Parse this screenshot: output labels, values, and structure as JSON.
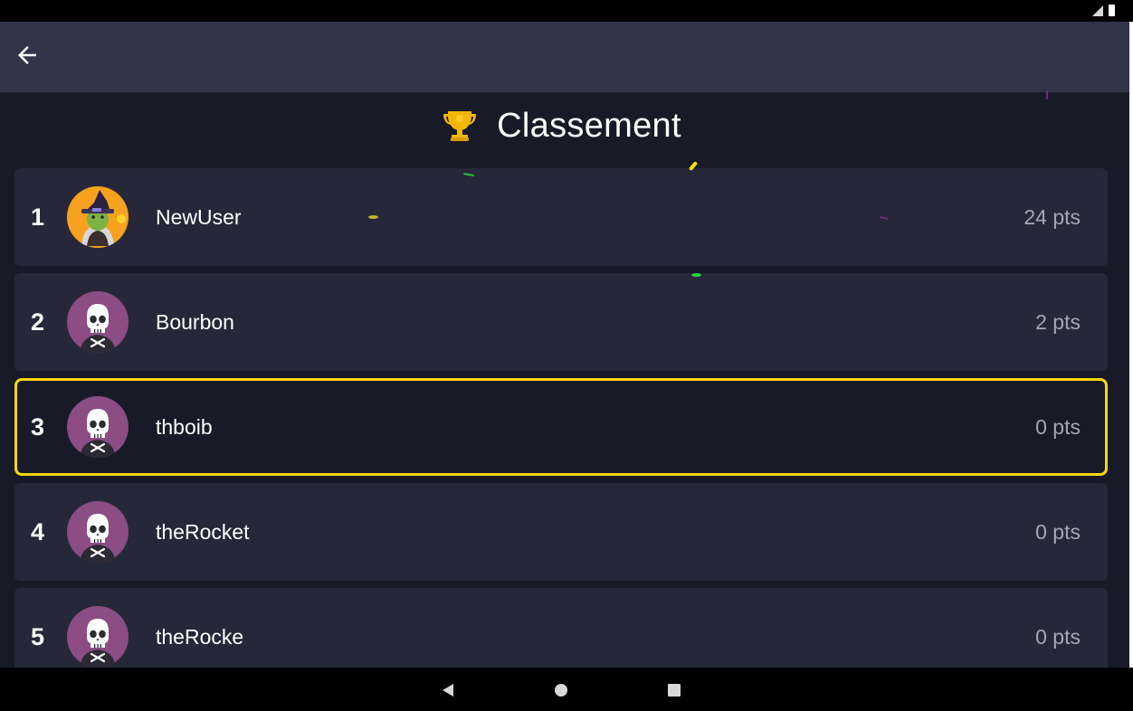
{
  "status_bar": {
    "icons": [
      "signal-icon",
      "battery-icon"
    ]
  },
  "app_bar": {
    "back_icon": "back-arrow-icon"
  },
  "heading": {
    "icon": "trophy-icon",
    "title": "Classement"
  },
  "leaderboard": {
    "rows": [
      {
        "rank": "1",
        "username": "NewUser",
        "points": "24 pts",
        "avatar": "witch-avatar",
        "current": false
      },
      {
        "rank": "2",
        "username": "Bourbon",
        "points": "2 pts",
        "avatar": "skull-avatar",
        "current": false
      },
      {
        "rank": "3",
        "username": "thboib",
        "points": "0 pts",
        "avatar": "skull-avatar",
        "current": true
      },
      {
        "rank": "4",
        "username": "theRocket",
        "points": "0 pts",
        "avatar": "skull-avatar",
        "current": false
      },
      {
        "rank": "5",
        "username": "theRocke",
        "points": "0 pts",
        "avatar": "skull-avatar",
        "current": false
      }
    ]
  },
  "nav_bar": {
    "buttons": [
      "back-triangle-icon",
      "home-circle-icon",
      "recents-square-icon"
    ]
  },
  "colors": {
    "background": "#181a27",
    "app_bar": "#323448",
    "row": "#262839",
    "highlight_border": "#ffd60a",
    "skull_avatar_bg": "#8b4d84",
    "witch_avatar_bg": "#f6a21e",
    "points_text": "#a5a7b3"
  }
}
